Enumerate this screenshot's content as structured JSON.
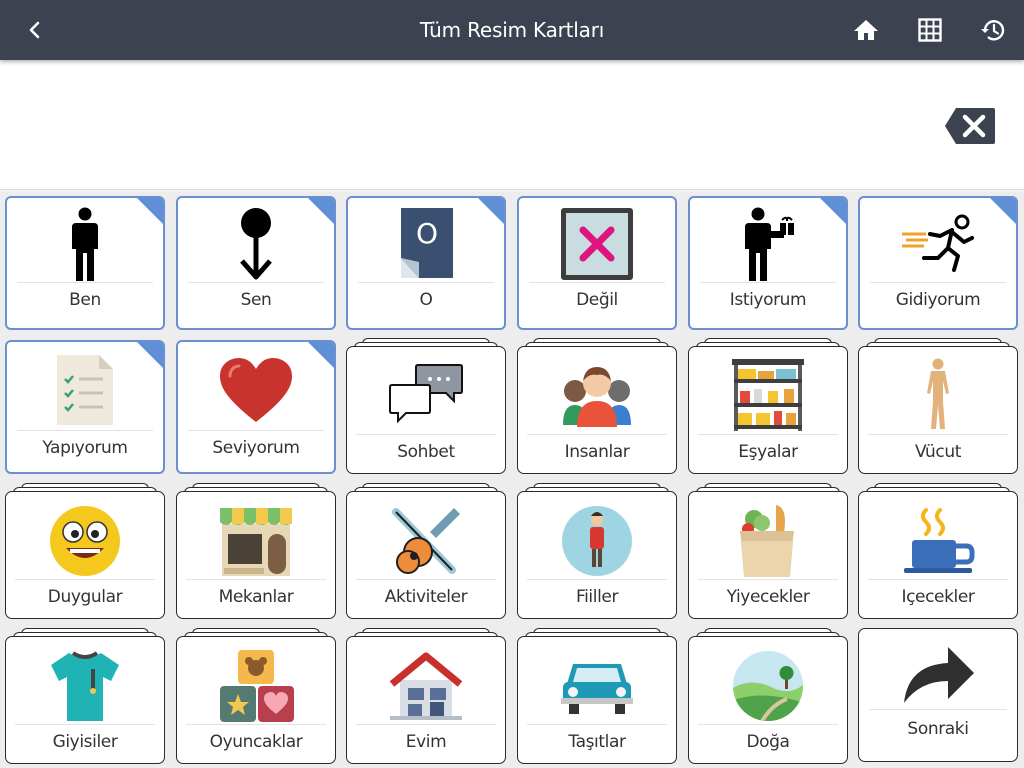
{
  "header": {
    "title": "Tüm Resim Kartları",
    "back_icon": "chevron-left-icon",
    "home_icon": "home-icon",
    "grid_icon": "grid-icon",
    "history_icon": "history-icon"
  },
  "sentence_strip": {
    "backspace_icon": "backspace-icon"
  },
  "colors": {
    "header_bg": "#3c4250",
    "card_border": "#6b8fd0",
    "card_corner": "#5f8fd6"
  },
  "cards": [
    {
      "label": "Ben",
      "icon": "person-icon",
      "type": "word"
    },
    {
      "label": "Sen",
      "icon": "pointing-down-icon",
      "type": "word"
    },
    {
      "label": "O",
      "icon": "letter-o-icon",
      "type": "word"
    },
    {
      "label": "Değil",
      "icon": "cross-box-icon",
      "type": "word"
    },
    {
      "label": "Istiyorum",
      "icon": "person-with-gift-icon",
      "type": "word"
    },
    {
      "label": "Gidiyorum",
      "icon": "running-person-icon",
      "type": "word"
    },
    {
      "label": "Yapıyorum",
      "icon": "checklist-icon",
      "type": "word"
    },
    {
      "label": "Seviyorum",
      "icon": "heart-icon",
      "type": "word"
    },
    {
      "label": "Sohbet",
      "icon": "chat-bubbles-icon",
      "type": "category"
    },
    {
      "label": "Insanlar",
      "icon": "people-icon",
      "type": "category"
    },
    {
      "label": "Eşyalar",
      "icon": "shelves-icon",
      "type": "category"
    },
    {
      "label": "Vücut",
      "icon": "body-icon",
      "type": "category"
    },
    {
      "label": "Duygular",
      "icon": "happy-face-icon",
      "type": "category"
    },
    {
      "label": "Mekanlar",
      "icon": "shop-icon",
      "type": "category"
    },
    {
      "label": "Aktiviteler",
      "icon": "guitar-icon",
      "type": "category"
    },
    {
      "label": "Fiiller",
      "icon": "standing-child-icon",
      "type": "category"
    },
    {
      "label": "Yiyecekler",
      "icon": "grocery-bag-icon",
      "type": "category"
    },
    {
      "label": "Içecekler",
      "icon": "coffee-cup-icon",
      "type": "category"
    },
    {
      "label": "Giyisiler",
      "icon": "tshirt-icon",
      "type": "category"
    },
    {
      "label": "Oyuncaklar",
      "icon": "toy-blocks-icon",
      "type": "category"
    },
    {
      "label": "Evim",
      "icon": "house-icon",
      "type": "category"
    },
    {
      "label": "Taşıtlar",
      "icon": "car-icon",
      "type": "category"
    },
    {
      "label": "Doğa",
      "icon": "landscape-icon",
      "type": "category"
    },
    {
      "label": "Sonraki",
      "icon": "forward-arrow-icon",
      "type": "next"
    }
  ]
}
